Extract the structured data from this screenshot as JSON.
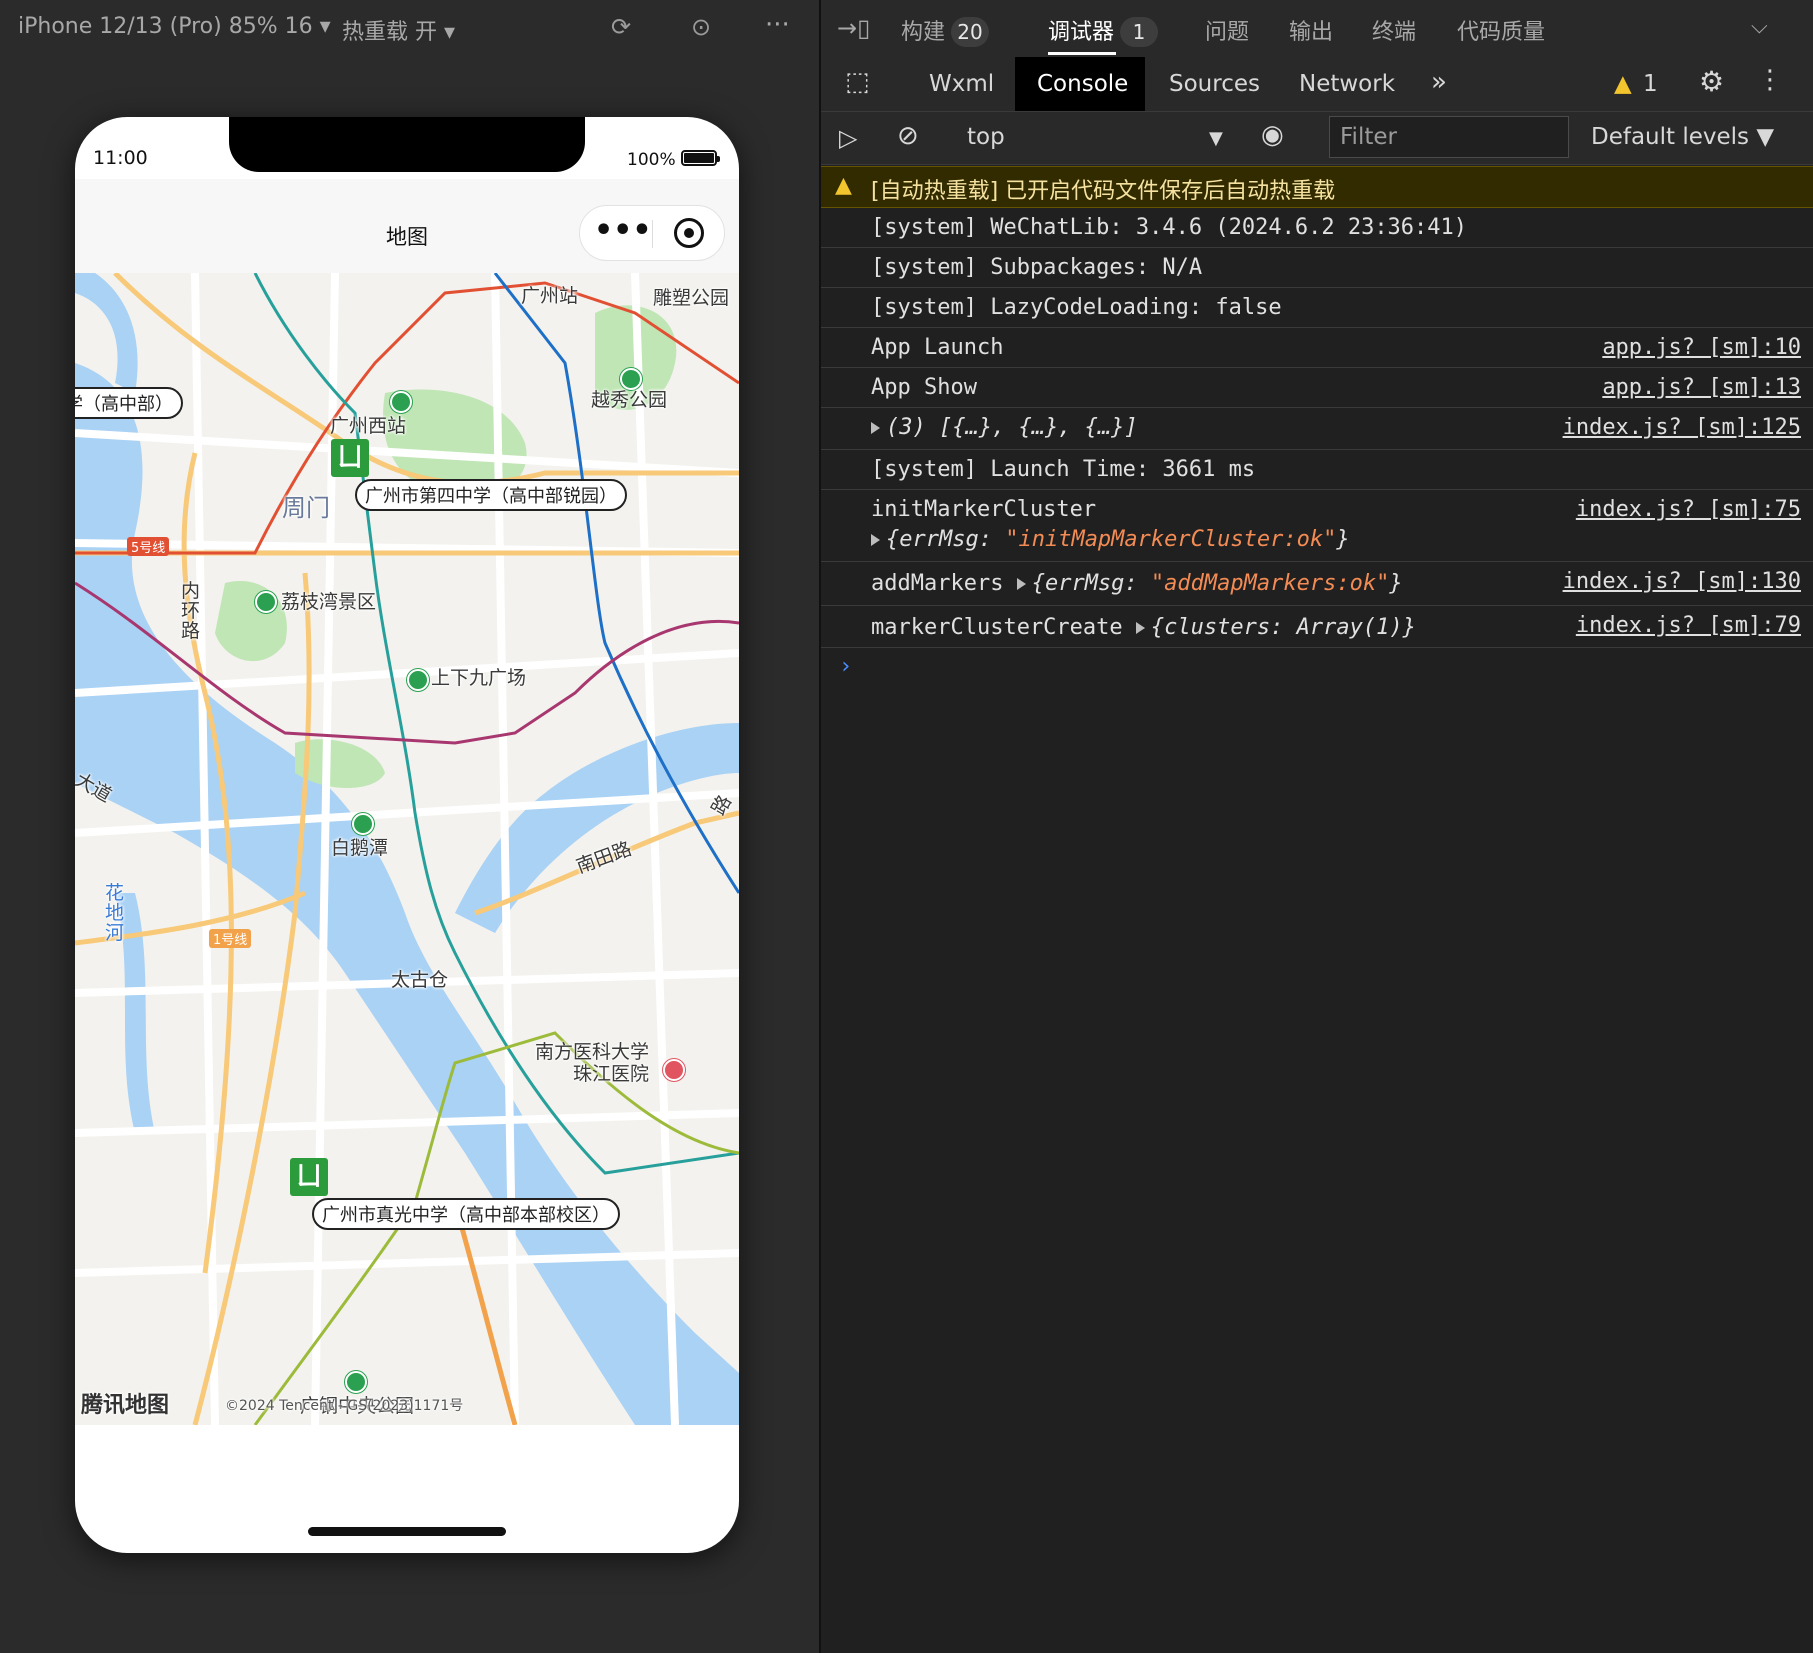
{
  "simulator": {
    "device_label": "iPhone 12/13 (Pro) 85% 16 ▾",
    "hotreload_label": "热重载 开 ▾",
    "more_label": "···",
    "status": {
      "time": "11:00",
      "battery": "100%"
    },
    "nav_title": "地图",
    "map": {
      "labels": {
        "guangzhou_station": "广州站",
        "sculpture_park": "雕塑公园",
        "school_left": "学（高中部）",
        "guangzhou_west": "广州西站",
        "yuexiu_park": "越秀公园",
        "school_4": "广州市第四中学（高中部锐园）",
        "zhoumen": "周门",
        "line5": "5号线",
        "inner_ring": "内\n环\n路",
        "lizhiwan": "荔枝湾景区",
        "shangxiajiu": "上下九广场",
        "dadao": "大道",
        "baietan": "白鹅潭",
        "huadihe": "花\n地\n河",
        "nantian": "南田路",
        "line1": "1号线",
        "taigucang": "太古仓",
        "hospital": "南方医科大学\n珠江医院",
        "school_zhenguang": "广州市真光中学（高中部本部校区）",
        "road_right": "路",
        "logo": "腾讯地图",
        "copyright": "©2024 Tencent - GS(2023)1171号",
        "steel_park": "广钢中央公园"
      }
    }
  },
  "devtools": {
    "top_tabs": [
      {
        "label": "构建",
        "badge": "20"
      },
      {
        "label": "调试器",
        "badge": "1"
      },
      {
        "label": "问题"
      },
      {
        "label": "输出"
      },
      {
        "label": "终端"
      },
      {
        "label": "代码质量"
      }
    ],
    "panel_tabs": [
      "Wxml",
      "Console",
      "Sources",
      "Network"
    ],
    "warning_count": "1",
    "context": "top",
    "filter_placeholder": "Filter",
    "levels": "Default levels ▼",
    "warning_message": "[自动热重载] 已开启代码文件保存后自动热重载",
    "logs": [
      {
        "msg": "[system] WeChatLib: 3.4.6 (2024.6.2 23:36:41)"
      },
      {
        "msg": "[system] Subpackages: N/A"
      },
      {
        "msg": "[system] LazyCodeLoading: false"
      },
      {
        "msg": "App Launch",
        "src": "app.js? [sm]:10"
      },
      {
        "msg": "App Show",
        "src": "app.js? [sm]:13"
      },
      {
        "msg": "(3) [{…}, {…}, {…}]",
        "src": "index.js? [sm]:125"
      },
      {
        "msg": "[system] Launch Time: 3661 ms"
      },
      {
        "msg": "initMarkerCluster",
        "obj_key": "errMsg: ",
        "obj_val": "\"initMapMarkerCluster:ok\"",
        "src": "index.js? [sm]:75"
      },
      {
        "msg": "addMarkers",
        "obj_key": "errMsg: ",
        "obj_val": "\"addMapMarkers:ok\"",
        "src": "index.js? [sm]:130"
      },
      {
        "msg": "markerClusterCreate",
        "obj_key": "clusters: ",
        "obj_val": "Array(1)",
        "src": "index.js? [sm]:79"
      }
    ],
    "prompt": "›"
  }
}
